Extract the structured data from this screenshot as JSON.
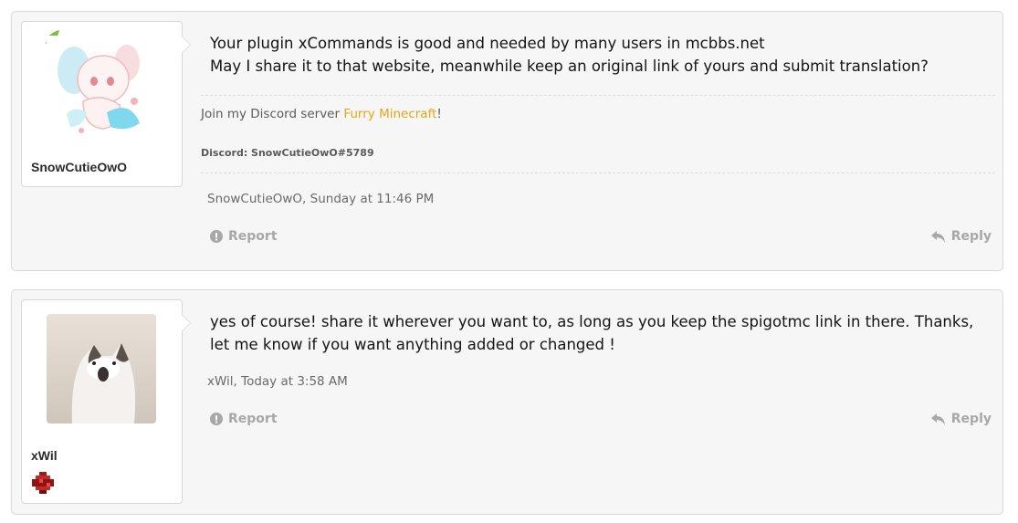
{
  "posts": [
    {
      "username": "SnowCutieOwO",
      "message_lines": [
        "Your plugin xCommands is good and needed by many users in mcbbs.net",
        "May I share it to that website, meanwhile keep an original link of yours and submit translation?"
      ],
      "signature": {
        "text_before": "Join my Discord server ",
        "link_text": "Furry Minecraft",
        "text_after": "!",
        "discord": "Discord: SnowCutieOwO#5789"
      },
      "meta": "SnowCutieOwO, Sunday at 11:46 PM",
      "report_label": "Report",
      "reply_label": "Reply"
    },
    {
      "username": "xWil",
      "message": "yes of course! share it wherever you want to, as long as you keep the spigotmc link in there. Thanks, let me know if you want anything added or changed !",
      "meta": "xWil, Today at 3:58 AM",
      "report_label": "Report",
      "reply_label": "Reply"
    }
  ],
  "colors": {
    "link": "#e5a515",
    "muted": "#a8a8a8",
    "online": "#7cc242"
  },
  "icons": [
    "online-badge-icon",
    "report-icon",
    "reply-icon",
    "redstone-trophy-icon"
  ]
}
